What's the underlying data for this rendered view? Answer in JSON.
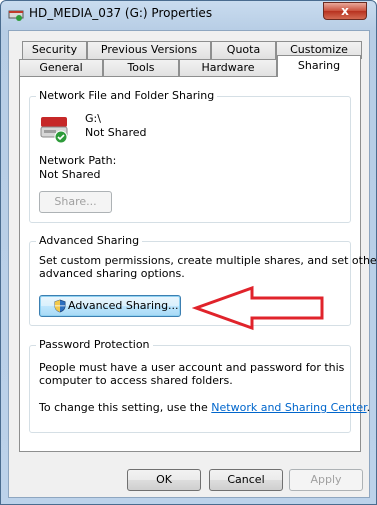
{
  "window": {
    "title": "HD_MEDIA_037 (G:) Properties",
    "close_label": "x"
  },
  "tabs": {
    "row1": [
      "Security",
      "Previous Versions",
      "Quota",
      "Customize"
    ],
    "row2": [
      "General",
      "Tools",
      "Hardware",
      "Sharing"
    ],
    "active": "Sharing"
  },
  "network_sharing": {
    "group_label": "Network File and Folder Sharing",
    "drive_name": "G:\\",
    "status": "Not Shared",
    "network_path_label": "Network Path:",
    "network_path_value": "Not Shared",
    "share_button": "Share..."
  },
  "advanced_sharing": {
    "group_label": "Advanced Sharing",
    "description_line1": "Set custom permissions, create multiple shares, and set other",
    "description_line2": "advanced sharing options.",
    "button_label": "Advanced Sharing..."
  },
  "password_protection": {
    "group_label": "Password Protection",
    "line1": "People must have a user account and password for this",
    "line2": "computer to access shared folders.",
    "change_prefix": "To change this setting, use the ",
    "link_text": "Network and Sharing Center",
    "change_suffix": "."
  },
  "footer": {
    "ok": "OK",
    "cancel": "Cancel",
    "apply": "Apply"
  },
  "colors": {
    "annotation_arrow": "#e0232b",
    "link": "#0066cc"
  },
  "icons": [
    "network-drive-title-icon",
    "close-icon",
    "drive-icon",
    "shared-check-icon",
    "uac-shield-icon",
    "red-arrow-annotation"
  ]
}
